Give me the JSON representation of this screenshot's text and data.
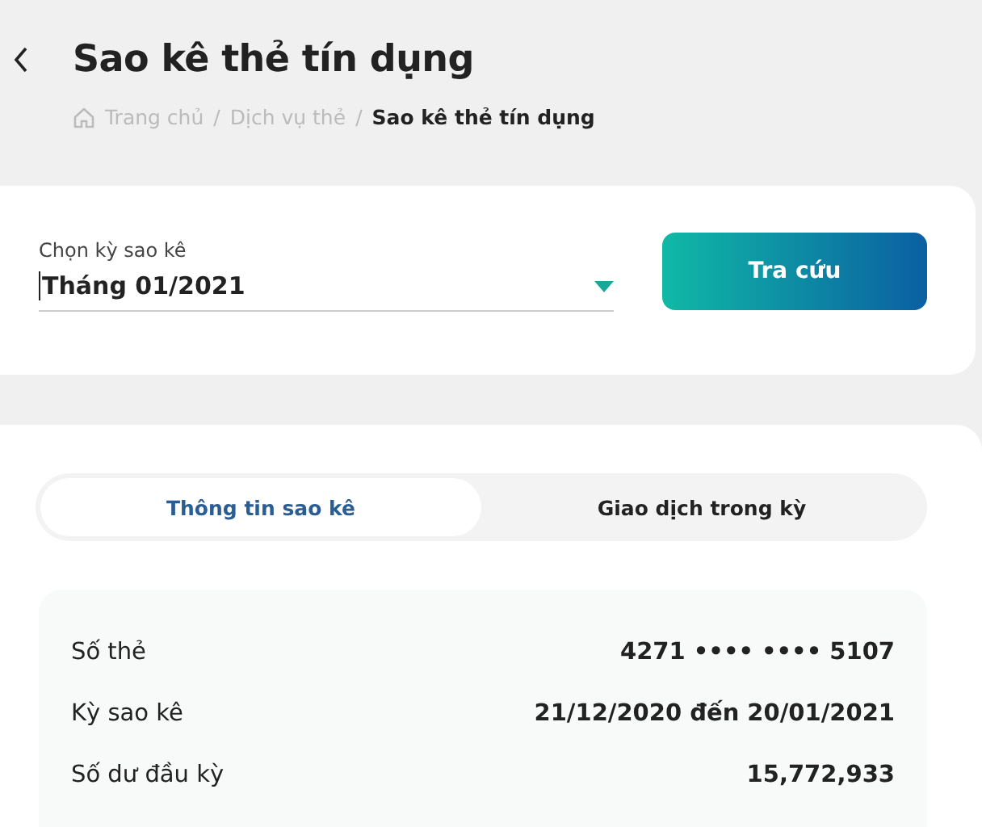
{
  "header": {
    "title": "Sao kê thẻ tín dụng"
  },
  "breadcrumb": [
    {
      "label": "Trang chủ"
    },
    {
      "separator": "/",
      "label": "Dịch vụ thẻ"
    },
    {
      "separator": "/",
      "label": "Sao kê thẻ tín dụng"
    }
  ],
  "period_picker": {
    "label": "Chọn kỳ sao kê",
    "value": "Tháng 01/2021",
    "button": "Tra cứu"
  },
  "tabs": [
    {
      "label": "Thông tin sao kê",
      "selected": true
    },
    {
      "label": "Giao dịch trong kỳ",
      "selected": false
    }
  ],
  "details": [
    {
      "label": "Số thẻ",
      "value": "4271 •••• •••• 5107"
    },
    {
      "label": "Kỳ sao kê",
      "value": "21/12/2020 đến 20/01/2021"
    },
    {
      "label": "Số dư đầu kỳ",
      "value": "15,772,933"
    }
  ]
}
